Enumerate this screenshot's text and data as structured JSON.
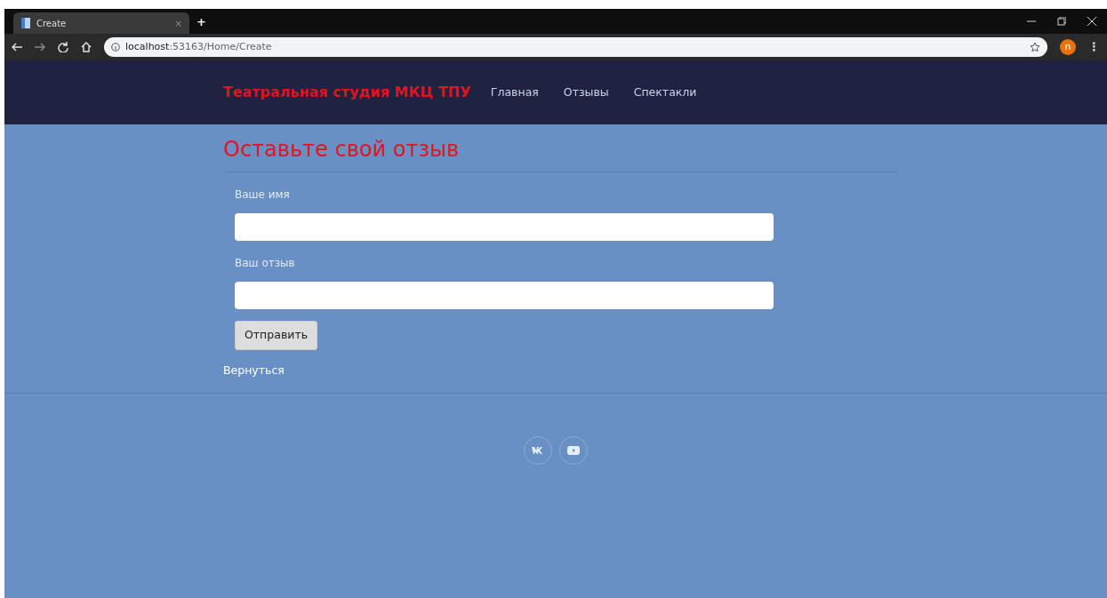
{
  "browser": {
    "tab_title": "Create",
    "close_tab": "×",
    "new_tab": "+",
    "url": "**localhost**:53163/Home/Create",
    "profile_initial": "n",
    "menu": "⋮"
  },
  "navbar": {
    "brand": "Театральная студия МКЦ ТПУ",
    "links": [
      {
        "label": "Главная"
      },
      {
        "label": "Отзывы"
      },
      {
        "label": "Спектакли"
      }
    ]
  },
  "heading": "Оставьте свой отзыв",
  "fields": [
    {
      "label": "Ваше имя"
    },
    {
      "label": "Ваш отзыв"
    }
  ],
  "submit": "Отправить",
  "back_link": "Вернуться",
  "footer": {
    "social": [
      {
        "kind": "vk"
      },
      {
        "kind": "video"
      }
    ]
  }
}
